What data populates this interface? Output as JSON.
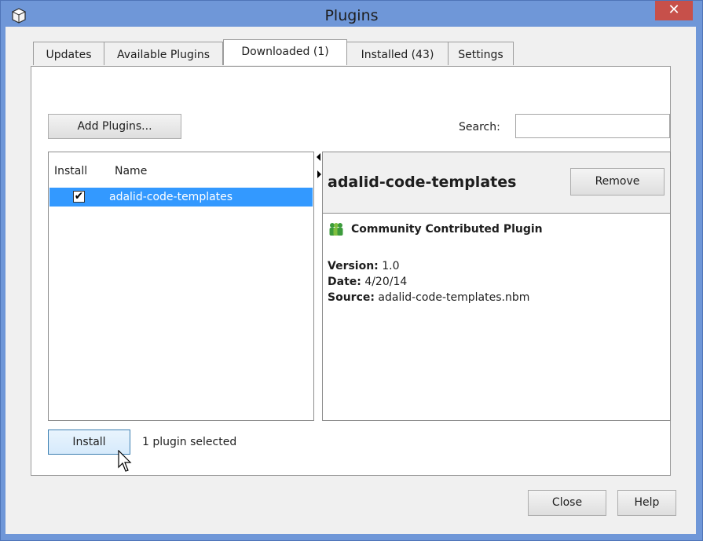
{
  "window": {
    "title": "Plugins",
    "close_glyph": "✕"
  },
  "tabs": [
    {
      "label": "Updates"
    },
    {
      "label": "Available Plugins"
    },
    {
      "label": "Downloaded (1)",
      "active": true
    },
    {
      "label": "Installed (43)"
    },
    {
      "label": "Settings"
    }
  ],
  "toolbar": {
    "add_plugins_label": "Add Plugins...",
    "search_label": "Search:",
    "search_value": ""
  },
  "list": {
    "columns": [
      "Install",
      "Name"
    ],
    "rows": [
      {
        "checked": true,
        "check_glyph": "✔",
        "name": "adalid-code-templates",
        "selected": true
      }
    ]
  },
  "detail": {
    "title": "adalid-code-templates",
    "remove_label": "Remove",
    "badge_text": "Community Contributed Plugin",
    "badge_icon": "community-people-icon",
    "version_label": "Version:",
    "version_value": "1.0",
    "date_label": "Date:",
    "date_value": "4/20/14",
    "source_label": "Source:",
    "source_value": "adalid-code-templates.nbm"
  },
  "footer": {
    "install_label": "Install",
    "status_text": "1 plugin selected",
    "close_label": "Close",
    "help_label": "Help"
  },
  "colors": {
    "titlebar": "#6f97d8",
    "close": "#c7504a",
    "selection": "#3399ff",
    "panel": "#f0f0f0"
  }
}
